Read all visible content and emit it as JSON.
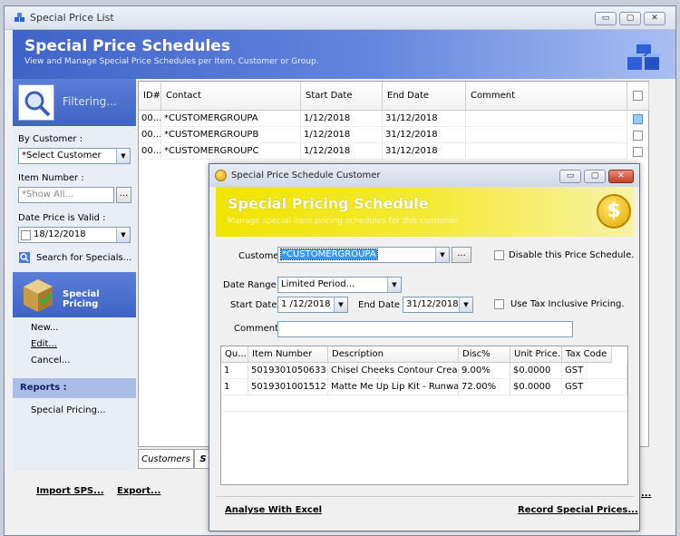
{
  "main": {
    "title": "Special Price List",
    "banner_title": "Special Price Schedules",
    "banner_subtitle": "View and Manage Special Price Schedules per Item, Customer or Group.",
    "controls": {
      "minimize": "▭",
      "maximize": "▢",
      "close": "✕"
    }
  },
  "filter": {
    "header": "Filtering...",
    "customer_label": "By Customer :",
    "customer_value": "*Select Customer",
    "item_label": "Item Number :",
    "item_placeholder": "*Show All...",
    "item_browse": "...",
    "date_label": "Date Price is Valid :",
    "date_value": "18/12/2018",
    "search_label": "Search for Specials..."
  },
  "special_pricing": {
    "header": "Special Pricing",
    "actions": [
      "New...",
      "Edit...",
      "Cancel..."
    ]
  },
  "reports": {
    "header": "Reports :",
    "items": [
      "Special Pricing..."
    ]
  },
  "grid": {
    "columns": [
      "ID#",
      "Contact",
      "Start Date",
      "End Date",
      "Comment"
    ],
    "rows": [
      {
        "id": "00...",
        "contact": "*CUSTOMERGROUPA",
        "start": "1/12/2018",
        "end": "31/12/2018",
        "comment": "",
        "checked": true
      },
      {
        "id": "00...",
        "contact": "*CUSTOMERGROUPB",
        "start": "1/12/2018",
        "end": "31/12/2018",
        "comment": "",
        "checked": false
      },
      {
        "id": "00...",
        "contact": "*CUSTOMERGROUPC",
        "start": "1/12/2018",
        "end": "31/12/2018",
        "comment": "",
        "checked": false
      }
    ]
  },
  "tabs": [
    "Customers",
    "S"
  ],
  "footer": {
    "import": "Import SPS...",
    "export": "Export...",
    "truncated": "..."
  },
  "dialog": {
    "title": "Special Price Schedule Customer",
    "banner_title": "Special Pricing Schedule",
    "banner_subtitle": "Manage special item pricing schedules for this customer.",
    "coin_symbol": "$",
    "customer_label": "Customer",
    "customer_value": "*CUSTOMERGROUPA",
    "customer_browse": "...",
    "disable_label": "Disable this Price Schedule.",
    "date_range_label": "Date Range :",
    "date_range_value": "Limited Period...",
    "start_label": "Start Date :",
    "start_value": "1 /12/2018",
    "end_label": "End Date :",
    "end_value": "31/12/2018",
    "tax_label": "Use Tax Inclusive Pricing.",
    "comment_label": "Comment :",
    "comment_value": "",
    "columns": [
      "Qu...",
      "Item Number",
      "Description",
      "Disc%",
      "Unit Price...",
      "Tax Code"
    ],
    "rows": [
      {
        "qty": "1",
        "item": "5019301050633",
        "desc": "Chisel Cheeks Contour Cream Pa",
        "disc": "9.00%",
        "price": "$0.0000",
        "tax": "GST"
      },
      {
        "qty": "1",
        "item": "5019301001512",
        "desc": "Matte Me Up Lip Kit - Runway",
        "disc": "72.00%",
        "price": "$0.0000",
        "tax": "GST"
      }
    ],
    "analyse": "Analyse With Excel",
    "record": "Record Special Prices..."
  },
  "colors": {
    "blue_banner": "#3f63c7",
    "yellow_banner": "#f0e400",
    "selection": "#3399ff"
  }
}
